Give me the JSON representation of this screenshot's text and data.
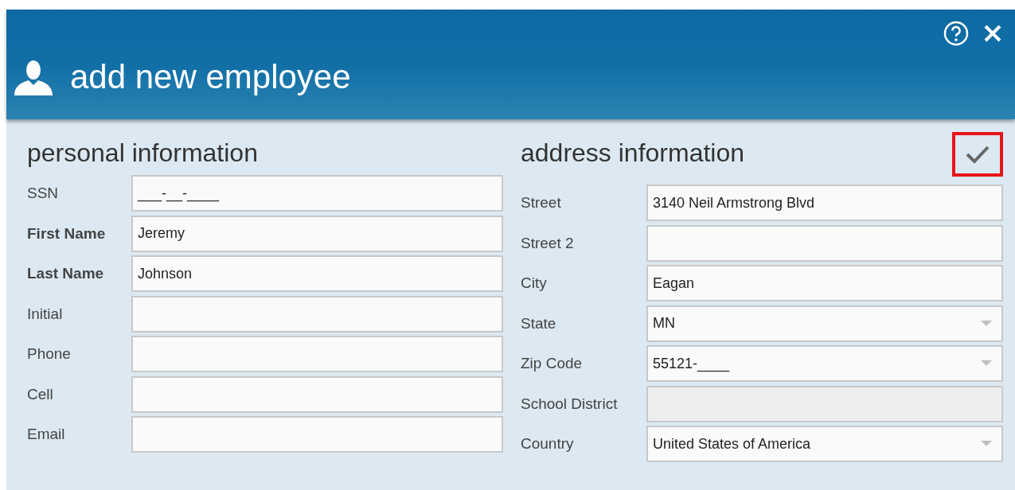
{
  "dialog": {
    "title": "add new employee"
  },
  "personal": {
    "heading": "personal information",
    "fields": [
      {
        "label": "SSN",
        "kind": "text",
        "required": false,
        "value": "___-__-____"
      },
      {
        "label": "First Name",
        "kind": "text",
        "required": true,
        "value": "Jeremy"
      },
      {
        "label": "Last Name",
        "kind": "text",
        "required": true,
        "value": "Johnson"
      },
      {
        "label": "Initial",
        "kind": "text",
        "required": false
      },
      {
        "label": "Phone",
        "kind": "text",
        "required": false
      },
      {
        "label": "Cell",
        "kind": "text",
        "required": false
      },
      {
        "label": "Email",
        "kind": "text",
        "required": false
      }
    ]
  },
  "address": {
    "heading": "address information",
    "save_button": {
      "highlighted": true
    },
    "fields": [
      {
        "label": "Street",
        "kind": "text",
        "required": false,
        "value": "3140 Neil Armstrong Blvd"
      },
      {
        "label": "Street 2",
        "kind": "text",
        "required": false
      },
      {
        "label": "City",
        "kind": "text",
        "required": false,
        "value": "Eagan"
      },
      {
        "label": "State",
        "kind": "dropdown",
        "required": false,
        "value": "MN"
      },
      {
        "label": "Zip Code",
        "kind": "dropdown",
        "required": false,
        "value": "55121-____"
      },
      {
        "label": "School District",
        "kind": "disabled",
        "required": false
      },
      {
        "label": "Country",
        "kind": "dropdown",
        "required": false,
        "value": "United States of America"
      }
    ]
  }
}
